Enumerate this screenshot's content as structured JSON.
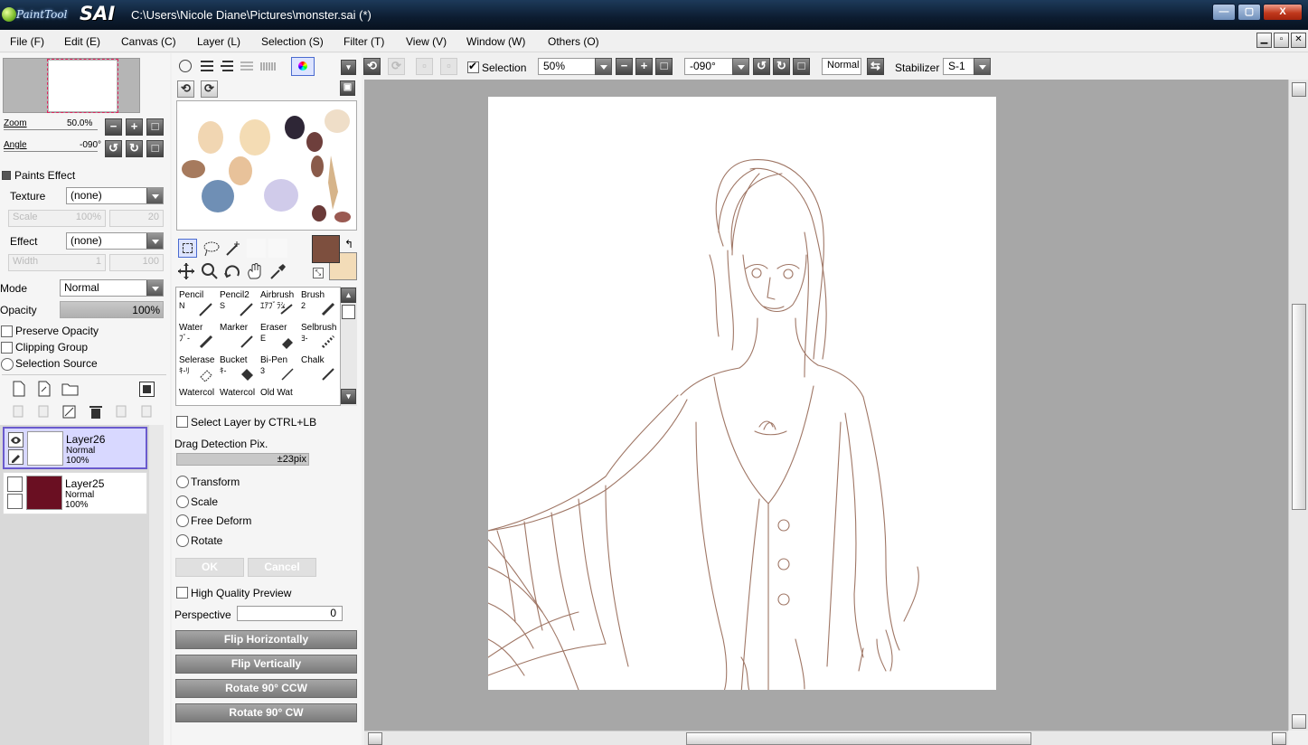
{
  "window": {
    "app_logo_text": "PaintTool",
    "app_logo_sai": "SAI",
    "title": "C:\\Users\\Nicole Diane\\Pictures\\monster.sai (*)",
    "minimize": "—",
    "maximize": "▢",
    "close": "X"
  },
  "menu": [
    {
      "label": "File (F)"
    },
    {
      "label": "Edit (E)"
    },
    {
      "label": "Canvas (C)"
    },
    {
      "label": "Layer (L)"
    },
    {
      "label": "Selection (S)"
    },
    {
      "label": "Filter (T)"
    },
    {
      "label": "View (V)"
    },
    {
      "label": "Window (W)"
    },
    {
      "label": "Others (O)"
    }
  ],
  "navigator": {
    "zoom_label": "Zoom",
    "zoom_value": "50.0%",
    "angle_label": "Angle",
    "angle_value": "-090°"
  },
  "paints_effect": {
    "header": "Paints Effect",
    "texture_label": "Texture",
    "texture_value": "(none)",
    "scale_label": "Scale",
    "scale_value": "100%",
    "scale_num": "20",
    "effect_label": "Effect",
    "effect_value": "(none)",
    "width_label": "Width",
    "width_value": "1",
    "width_num": "100"
  },
  "layer_props": {
    "mode_label": "Mode",
    "mode_value": "Normal",
    "opacity_label": "Opacity",
    "opacity_value": "100%",
    "preserve_opacity": "Preserve Opacity",
    "clipping_group": "Clipping Group",
    "selection_source": "Selection Source"
  },
  "layers": [
    {
      "name": "Layer26",
      "mode": "Normal",
      "opacity": "100%",
      "selected": true,
      "thumb_color": "#ffffff"
    },
    {
      "name": "Layer25",
      "mode": "Normal",
      "opacity": "100%",
      "selected": false,
      "thumb_color": "#6a0f22"
    }
  ],
  "colors": {
    "primary": "#7d4f3e",
    "secondary": "#f3dcb8"
  },
  "scratchpad_blobs": [
    {
      "color": "#f1d6b2"
    },
    {
      "color": "#f4dcb4"
    },
    {
      "color": "#2e2636"
    },
    {
      "color": "#6e3f3c"
    },
    {
      "color": "#a67a5d"
    },
    {
      "color": "#e8c29a"
    },
    {
      "color": "#6f8fb5"
    },
    {
      "color": "#d0cbea"
    },
    {
      "color": "#d6b48a"
    },
    {
      "color": "#6a3a38"
    }
  ],
  "brushes": [
    {
      "name": "Pencil",
      "key": "N"
    },
    {
      "name": "Pencil2",
      "key": "S"
    },
    {
      "name": "Airbrush",
      "key": "ｴｱﾌﾞﾗｼ"
    },
    {
      "name": "Brush",
      "key": "2"
    },
    {
      "name": "Water",
      "key": "ﾌﾞ-"
    },
    {
      "name": "Marker",
      "key": ""
    },
    {
      "name": "Eraser",
      "key": "E"
    },
    {
      "name": "Selbrush",
      "key": "ﾖ-"
    },
    {
      "name": "Selerase",
      "key": "ｷ-ﾘ"
    },
    {
      "name": "Bucket",
      "key": "ｷ-"
    },
    {
      "name": "Bi-Pen",
      "key": "3"
    },
    {
      "name": "Chalk",
      "key": ""
    },
    {
      "name": "Watercol",
      "key": ""
    },
    {
      "name": "Watercol",
      "key": ""
    },
    {
      "name": "Old Wat",
      "key": ""
    }
  ],
  "transform_panel": {
    "select_layer_label": "Select Layer by CTRL+LB",
    "drag_detection_label": "Drag Detection Pix.",
    "drag_value": "±23pix",
    "transform": "Transform",
    "scale": "Scale",
    "free_deform": "Free Deform",
    "rotate": "Rotate",
    "ok": "OK",
    "cancel": "Cancel",
    "high_quality": "High Quality Preview",
    "perspective_label": "Perspective",
    "perspective_value": "0",
    "flip_h": "Flip Horizontally",
    "flip_v": "Flip Vertically",
    "rot_ccw": "Rotate 90° CCW",
    "rot_cw": "Rotate 90° CW"
  },
  "toolbar": {
    "selection_label": "Selection",
    "selection_checked": true,
    "zoom_value": "50%",
    "angle_value": "-090°",
    "blend_value": "Normal",
    "stabilizer_label": "Stabilizer",
    "stabilizer_value": "S-1"
  },
  "canvas": {
    "bg": "#a7a7a7",
    "paper": "#ffffff",
    "stroke": "#8f5f4b"
  }
}
